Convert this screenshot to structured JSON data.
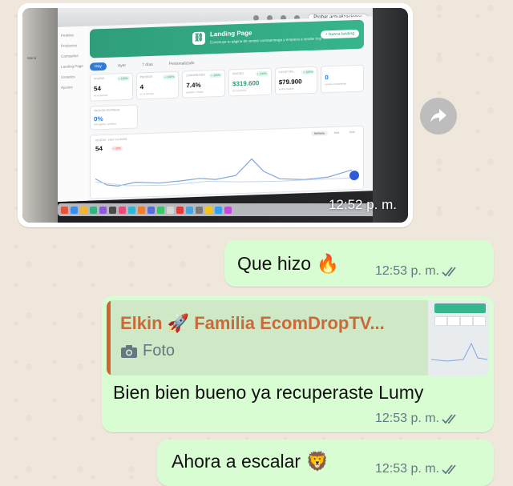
{
  "photo": {
    "landing": {
      "title": "Landing Page",
      "subtitle": "Construye tu página de ventas contraentrega y empieza a vender hoy",
      "new_button": "+ Nueva landing",
      "tabs": [
        "Hoy",
        "Ayer",
        "7 días",
        "Personalizado"
      ],
      "cards": [
        {
          "label": "VISITAS",
          "value": "54",
          "chip": "+ 100%",
          "note": "en el periodo",
          "tone": "default"
        },
        {
          "label": "PEDIDOS",
          "value": "4",
          "chip": "+ 100%",
          "note": "en el periodo",
          "tone": "default"
        },
        {
          "label": "CONVERSIÓN",
          "value": "7.4%",
          "chip": "+ 100%",
          "note": "pedidos / visitas",
          "tone": "default"
        },
        {
          "label": "VENTAS",
          "value": "$319.600",
          "chip": "+ 100%",
          "note": "en el periodo",
          "tone": "green"
        },
        {
          "label": "TICKET PR...",
          "value": "$79.900",
          "chip": "+ 100%",
          "note": "venta / pedido",
          "tone": "default"
        },
        {
          "label": "",
          "value": "0",
          "chip": "",
          "note": "ventas completadas",
          "tone": "blue"
        }
      ],
      "conversion_card": {
        "label": "TASA DE ENTREGA",
        "value": "0%",
        "note": "entregados / pedidos"
      },
      "chart_panel": {
        "label": "VISITAS · HOY VS AYER",
        "value": "54",
        "chip": "+ 26%",
        "tabs": [
          "Semana",
          "Mes",
          "Todo"
        ]
      },
      "sidebar": [
        "Menú",
        "Pedidos",
        "Productos",
        "Campañas",
        "Landing Page",
        "Usuarios",
        "Ajustes"
      ],
      "menu_bar_right": "Probar actualizaciones"
    },
    "time": "12:52 p. m."
  },
  "messages": [
    {
      "text": "Que hizo",
      "emoji": "🔥",
      "time": "12:53 p. m."
    },
    {
      "quote_author": "Elkin 🚀 Familia EcomDropTV...",
      "quote_type": "Foto",
      "text": "Bien bien bueno ya recuperaste Lumy",
      "time": "12:53 p. m."
    },
    {
      "text": "Ahora a escalar",
      "emoji": "🦁",
      "time": "12:53 p. m."
    }
  ],
  "colors": {
    "background": "#efe7dc",
    "outgoing_bubble": "#d9fdd3",
    "quote_background": "#cfe9c6",
    "quote_author": "#c86a3a",
    "meta_text": "#667781",
    "landing_accent": "#2f9d7a"
  },
  "icons": [
    "forward-icon",
    "camera-icon",
    "double-check-icon"
  ]
}
